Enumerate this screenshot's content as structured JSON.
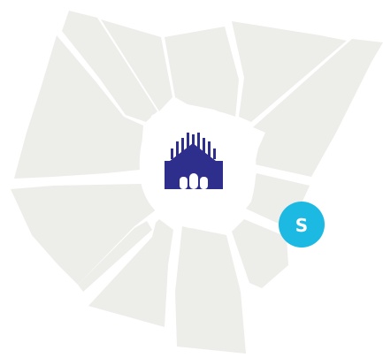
{
  "map": {
    "colors": {
      "background": "#ffffff",
      "district": "#ededea",
      "center": "#ffffff",
      "landmark": "#2e2f8c",
      "marker": "#1cb9e3",
      "marker_text": "#ffffff"
    },
    "landmark": {
      "icon": "cathedral-icon"
    },
    "marker": {
      "icon": "location-marker-icon",
      "label": "S"
    }
  }
}
